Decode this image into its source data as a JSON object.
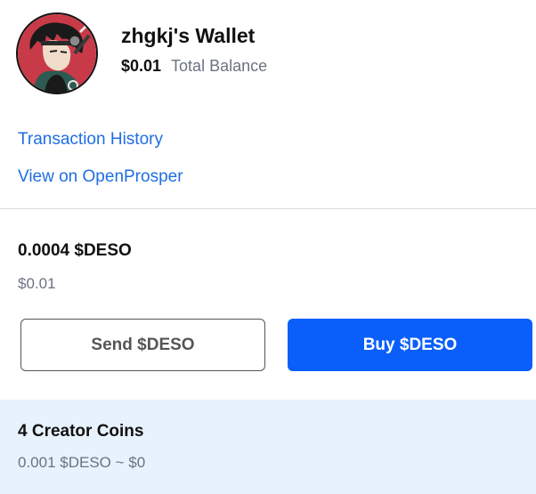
{
  "header": {
    "title": "zhgkj's Wallet",
    "balance_amount": "$0.01",
    "balance_label": "Total Balance",
    "avatar_icon": "user-avatar"
  },
  "links": {
    "transaction_history": "Transaction History",
    "view_openprosper": "View on OpenProsper"
  },
  "deso": {
    "amount": "0.0004 $DESO",
    "usd_value": "$0.01"
  },
  "actions": {
    "send_label": "Send $DESO",
    "buy_label": "Buy $DESO"
  },
  "creator_coins": {
    "title": "4 Creator Coins",
    "subtitle": "0.001 $DESO ~ $0"
  },
  "colors": {
    "accent": "#0a5ffb",
    "link": "#1f6fe0",
    "muted": "#6b7280",
    "creator_bg": "#e8f2fd"
  }
}
